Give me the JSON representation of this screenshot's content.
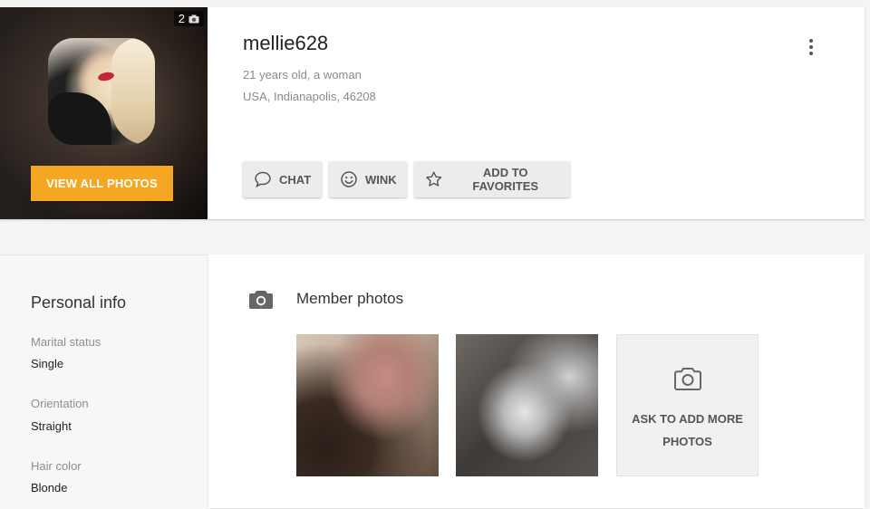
{
  "profile": {
    "photo_count": "2",
    "view_all_photos_label": "VIEW ALL PHOTOS",
    "username": "mellie628",
    "age_gender": "21 years old, a woman",
    "location": "USA, Indianapolis, 46208",
    "actions": {
      "chat": "CHAT",
      "wink": "WINK",
      "favorites": "ADD TO FAVORITES"
    },
    "icons": {
      "more": "more-vertical-icon",
      "chat": "chat-bubble-icon",
      "wink": "smiley-icon",
      "favorites": "star-icon",
      "photo_count": "camera-icon"
    }
  },
  "personal_info": {
    "title": "Personal info",
    "fields": [
      {
        "label": "Marital status",
        "value": "Single"
      },
      {
        "label": "Orientation",
        "value": "Straight"
      },
      {
        "label": "Hair color",
        "value": "Blonde"
      }
    ]
  },
  "member_photos": {
    "title": "Member photos",
    "icon": "camera-icon",
    "ask_more": {
      "line1": "ASK TO ADD MORE",
      "line2": "PHOTOS",
      "icon": "camera-outline-icon"
    }
  },
  "colors": {
    "accent": "#f5a623",
    "background": "#f4f4f4",
    "button_bg": "#ececec"
  }
}
